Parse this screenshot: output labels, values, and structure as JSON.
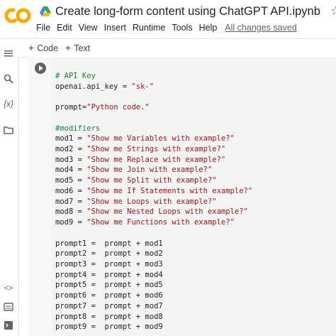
{
  "app": {
    "logo_text": "CO",
    "title": "Create long-form content using ChatGPT API.ipynb",
    "star_icon": "star-outline-icon",
    "accent": "#f9ab00"
  },
  "menu": {
    "items": [
      "File",
      "Edit",
      "View",
      "Insert",
      "Runtime",
      "Tools",
      "Help"
    ],
    "status": "All changes saved"
  },
  "toolbar": {
    "code_label": "Code",
    "text_label": "Text"
  },
  "sidebar": {
    "icons": [
      "menu-icon",
      "search-icon",
      "variables-icon",
      "folder-icon",
      "code-snippets-icon",
      "command-palette-icon",
      "terminal-icon"
    ]
  },
  "cell": {
    "lines": [
      {
        "kind": "cm",
        "text": "# API Key"
      },
      {
        "kind": "pl",
        "text": "openai.api_key = ",
        "str": "\"sk-\""
      },
      {
        "kind": "pl",
        "text": "",
        "str": ""
      },
      {
        "kind": "pl",
        "text": "prompt=",
        "str": "\"Python code.\""
      },
      {
        "kind": "pl",
        "text": "",
        "str": ""
      },
      {
        "kind": "cm",
        "text": "#modifiers"
      },
      {
        "kind": "pl",
        "text": "mod1 = ",
        "str": "\"Show me Variables with example?\""
      },
      {
        "kind": "pl",
        "text": "mod2 = ",
        "str": "\"Show me Strings with example?\""
      },
      {
        "kind": "pl",
        "text": "mod3 = ",
        "str": "\"Show me Replace with example?\""
      },
      {
        "kind": "pl",
        "text": "mod4 = ",
        "str": "\"Show me Join with example?\""
      },
      {
        "kind": "pl",
        "text": "mod5 = ",
        "str": "\"Show me Split with example?\""
      },
      {
        "kind": "pl",
        "text": "mod6 = ",
        "str": "\"Show me If Statements with example?\""
      },
      {
        "kind": "pl",
        "text": "mod7 = ",
        "str": "\"Show me Loops with example?\""
      },
      {
        "kind": "pl",
        "text": "mod8 = ",
        "str": "\"Show me Nested Loops with example?\""
      },
      {
        "kind": "pl",
        "text": "mod9 = ",
        "str": "\"Show me Functions with example?\""
      },
      {
        "kind": "pl",
        "text": "",
        "str": ""
      },
      {
        "kind": "pl",
        "text": "prompt1 =  prompt + mod1",
        "str": ""
      },
      {
        "kind": "pl",
        "text": "prompt2 =  prompt + mod2",
        "str": ""
      },
      {
        "kind": "pl",
        "text": "prompt3 =  prompt + mod3",
        "str": ""
      },
      {
        "kind": "pl",
        "text": "prompt4 =  prompt + mod4",
        "str": ""
      },
      {
        "kind": "pl",
        "text": "prompt5 =  prompt + mod5",
        "str": ""
      },
      {
        "kind": "pl",
        "text": "prompt6 =  prompt + mod6",
        "str": ""
      },
      {
        "kind": "pl",
        "text": "prompt7 =  prompt + mod7",
        "str": ""
      },
      {
        "kind": "pl",
        "text": "prompt8 =  prompt + mod8",
        "str": ""
      },
      {
        "kind": "pl",
        "text": "prompt9 =  prompt + mod9",
        "str": ""
      }
    ]
  }
}
